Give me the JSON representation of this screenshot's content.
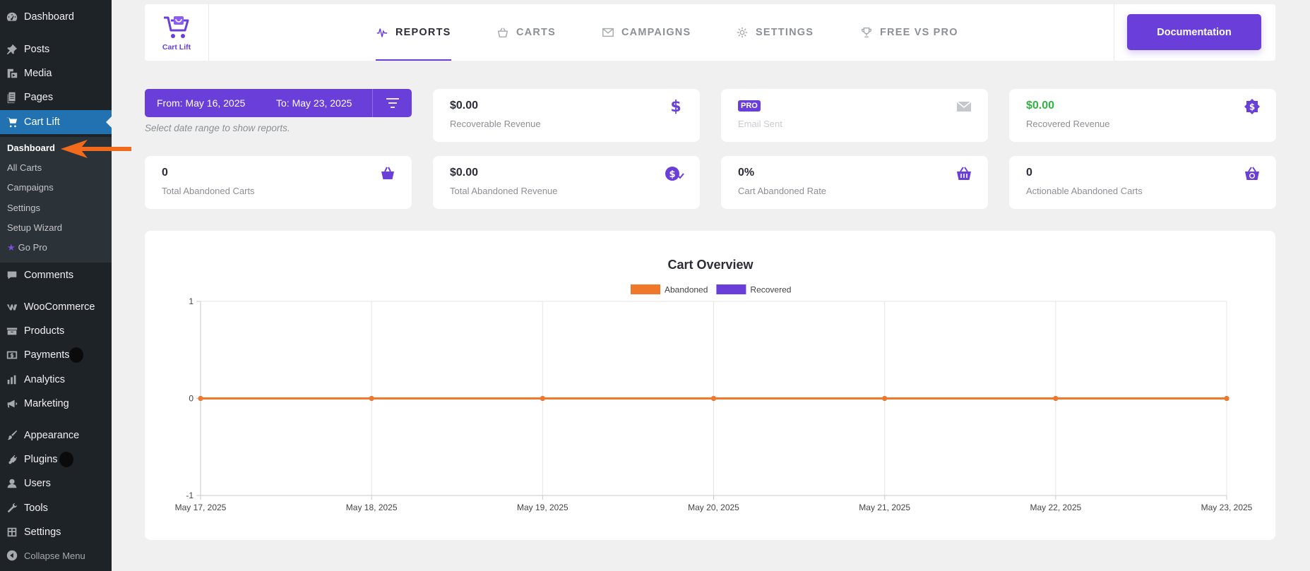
{
  "sidebar": {
    "items": [
      {
        "label": "Dashboard",
        "icon": "dashboard-icon"
      },
      {
        "label": "Posts",
        "icon": "pin-icon"
      },
      {
        "label": "Media",
        "icon": "media-icon"
      },
      {
        "label": "Pages",
        "icon": "pages-icon"
      },
      {
        "label": "Cart Lift",
        "icon": "cart-icon"
      },
      {
        "label": "Comments",
        "icon": "comment-icon"
      },
      {
        "label": "WooCommerce",
        "icon": "woo-icon"
      },
      {
        "label": "Products",
        "icon": "products-icon"
      },
      {
        "label": "Payments",
        "icon": "payments-icon"
      },
      {
        "label": "Analytics",
        "icon": "analytics-icon"
      },
      {
        "label": "Marketing",
        "icon": "megaphone-icon"
      },
      {
        "label": "Appearance",
        "icon": "brush-icon"
      },
      {
        "label": "Plugins",
        "icon": "plug-icon"
      },
      {
        "label": "Users",
        "icon": "user-icon"
      },
      {
        "label": "Tools",
        "icon": "wrench-icon"
      },
      {
        "label": "Settings",
        "icon": "settings-icon"
      },
      {
        "label": "Collapse Menu",
        "icon": "collapse-icon"
      }
    ],
    "submenu": [
      "Dashboard",
      "All Carts",
      "Campaigns",
      "Settings",
      "Setup Wizard",
      "Go Pro"
    ]
  },
  "topnav": {
    "logo_text": "Cart Lift",
    "tabs": [
      "REPORTS",
      "CARTS",
      "CAMPAIGNS",
      "SETTINGS",
      "FREE VS PRO"
    ],
    "active_tab": "REPORTS",
    "doc_button": "Documentation"
  },
  "date_range": {
    "from": "From: May 16, 2025",
    "to": "To: May 23, 2025",
    "hint": "Select date range to show reports."
  },
  "stats": [
    {
      "value": "$0.00",
      "label": "Recoverable Revenue",
      "icon": "dollar-icon"
    },
    {
      "badge": "PRO",
      "label": "Email Sent",
      "icon": "envelope-icon"
    },
    {
      "value": "$0.00",
      "label": "Recovered Revenue",
      "icon": "dollar-badge-icon",
      "value_color": "#2fb344"
    },
    {
      "value": "0",
      "label": "Total Abandoned Carts",
      "icon": "basket-icon"
    },
    {
      "value": "$0.00",
      "label": "Total Abandoned Revenue",
      "icon": "dollar-check-icon"
    },
    {
      "value": "0%",
      "label": "Cart Abandoned Rate",
      "icon": "basket-lines-icon"
    },
    {
      "value": "0",
      "label": "Actionable Abandoned Carts",
      "icon": "basket-clock-icon"
    }
  ],
  "colors": {
    "accent": "#6a3fd9",
    "abandoned": "#f0782a",
    "recovered": "#6a3fd9",
    "wp_sidebar": "#1d2327",
    "wp_active": "#2271b1"
  },
  "chart_data": {
    "type": "line",
    "title": "Cart Overview",
    "categories": [
      "May 17, 2025",
      "May 18, 2025",
      "May 19, 2025",
      "May 20, 2025",
      "May 21, 2025",
      "May 22, 2025",
      "May 23, 2025"
    ],
    "series": [
      {
        "name": "Abandoned",
        "values": [
          0,
          0,
          0,
          0,
          0,
          0,
          0
        ],
        "color": "#f0782a"
      },
      {
        "name": "Recovered",
        "values": [
          0,
          0,
          0,
          0,
          0,
          0,
          0
        ],
        "color": "#6a3fd9"
      }
    ],
    "yticks": [
      "1",
      "0",
      "-1"
    ],
    "ylim": [
      -1,
      1
    ],
    "grid": true,
    "legend": "top-center"
  }
}
